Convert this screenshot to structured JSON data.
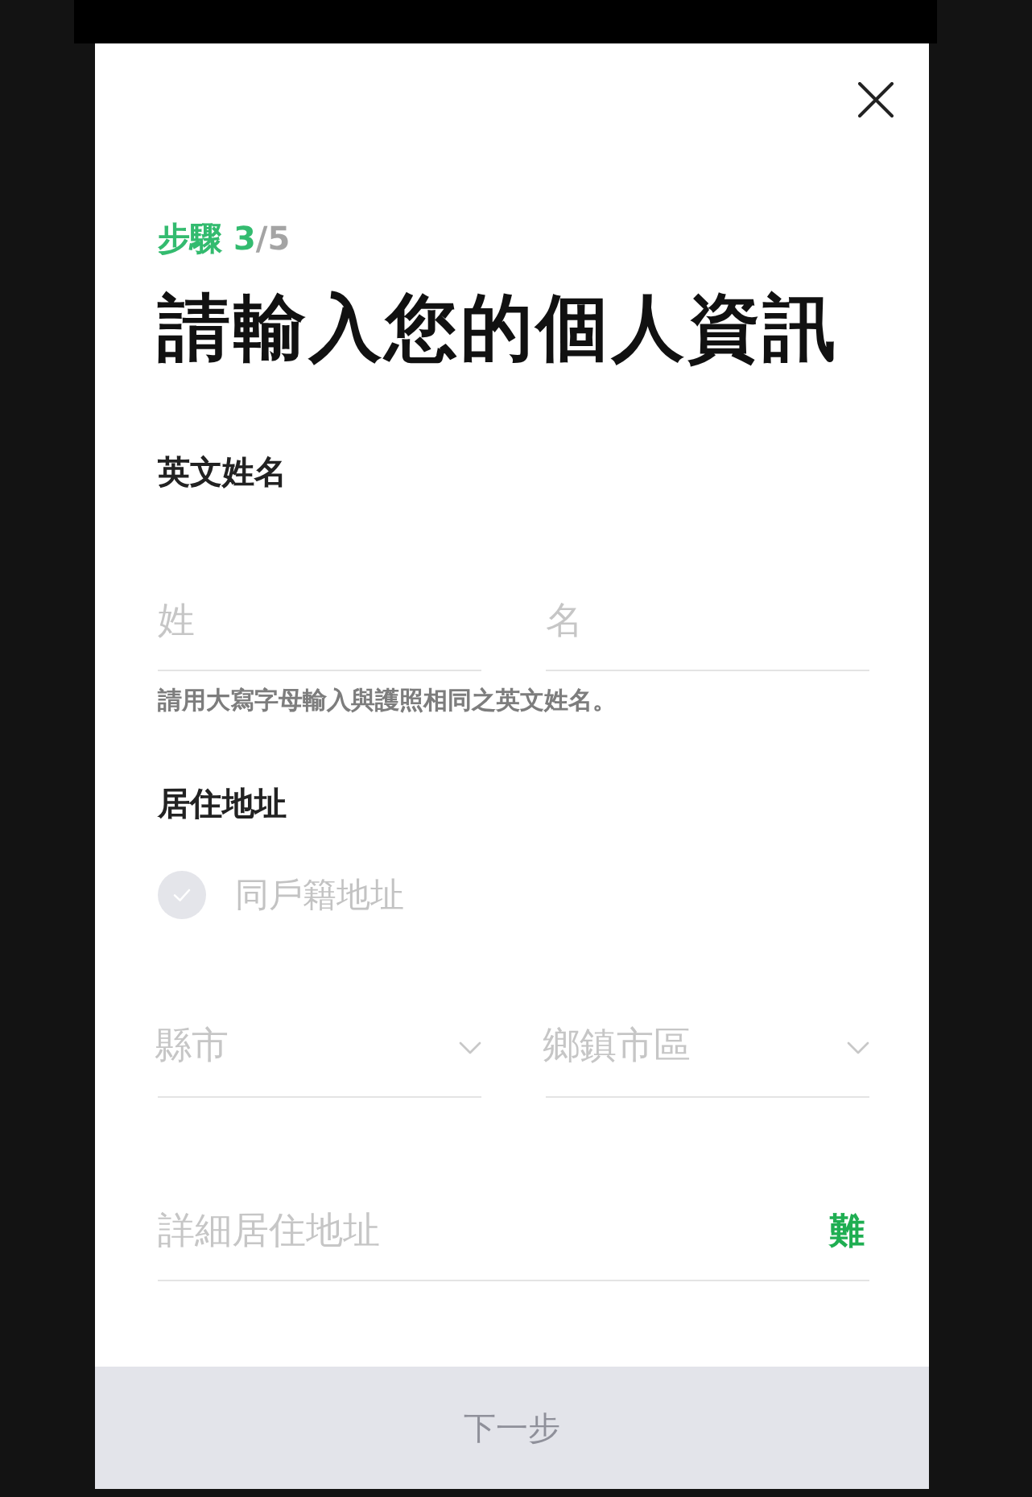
{
  "step": {
    "label": "步驟 3",
    "separator": "/",
    "total": "5"
  },
  "title": "請輸入您的個人資訊",
  "english_name": {
    "heading": "英文姓名",
    "fields": [
      {
        "placeholder": "姓"
      },
      {
        "placeholder": "名"
      }
    ],
    "hint": "請用大寫字母輸入與護照相同之英文姓名。"
  },
  "address": {
    "heading": "居住地址",
    "same_as_registered": {
      "label": "同戶籍地址",
      "checked": false
    },
    "dropdowns": [
      {
        "placeholder": "縣市"
      },
      {
        "placeholder": "鄉鎮市區"
      }
    ],
    "detail": {
      "placeholder": "詳細居住地址",
      "suffix": "難"
    }
  },
  "next_button": {
    "label": "下一步",
    "disabled": true
  }
}
